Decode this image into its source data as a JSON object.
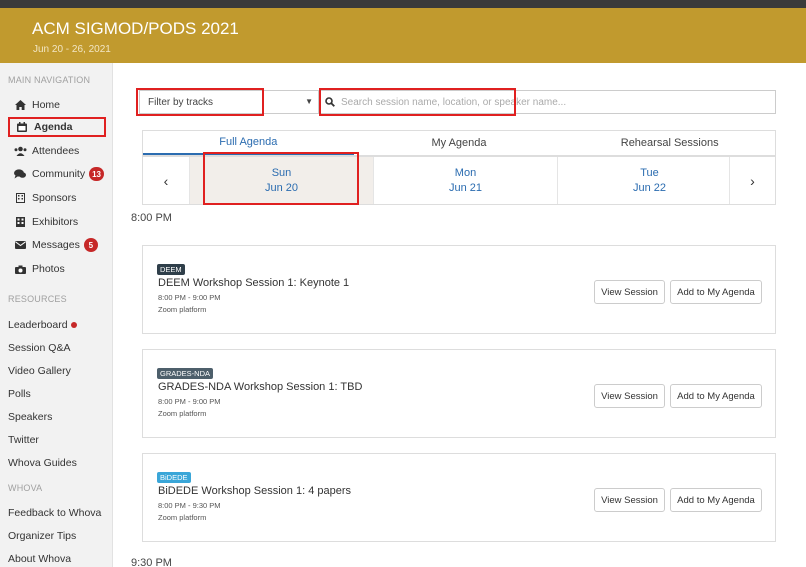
{
  "header": {
    "title": "ACM SIGMOD/PODS 2021",
    "dates": "Jun 20 - 26, 2021"
  },
  "sidebar": {
    "main_heading": "MAIN NAVIGATION",
    "items": [
      {
        "label": "Home",
        "icon": "home-icon"
      },
      {
        "label": "Agenda",
        "icon": "calendar-icon"
      },
      {
        "label": "Attendees",
        "icon": "users-icon"
      },
      {
        "label": "Community",
        "icon": "chat-icon",
        "badge": "13"
      },
      {
        "label": "Sponsors",
        "icon": "building-icon"
      },
      {
        "label": "Exhibitors",
        "icon": "exhibitor-icon"
      },
      {
        "label": "Messages",
        "icon": "envelope-icon",
        "badge": "5"
      },
      {
        "label": "Photos",
        "icon": "camera-icon"
      }
    ],
    "resources_heading": "RESOURCES",
    "resources": [
      "Leaderboard",
      "Session Q&A",
      "Video Gallery",
      "Polls",
      "Speakers",
      "Twitter",
      "Whova Guides"
    ],
    "whova_heading": "WHOVA",
    "whova": [
      "Feedback to Whova",
      "Organizer Tips",
      "About Whova"
    ]
  },
  "filter": {
    "label": "Filter by tracks"
  },
  "search": {
    "placeholder": "Search session name, location, or speaker name..."
  },
  "tabs": [
    "Full Agenda",
    "My Agenda",
    "Rehearsal Sessions"
  ],
  "days": [
    {
      "weekday": "Sun",
      "date": "Jun 20"
    },
    {
      "weekday": "Mon",
      "date": "Jun 21"
    },
    {
      "weekday": "Tue",
      "date": "Jun 22"
    }
  ],
  "times": [
    "8:00 PM",
    "9:30 PM"
  ],
  "sessions": [
    {
      "tag": "DEEM",
      "tag_color": "#2f3f4a",
      "title": "DEEM Workshop Session 1: Keynote 1",
      "time": "8:00 PM - 9:00 PM",
      "location": "Zoom platform"
    },
    {
      "tag": "GRADES-NDA",
      "tag_color": "#4d5f6b",
      "title": "GRADES-NDA Workshop Session 1: TBD",
      "time": "8:00 PM - 9:00 PM",
      "location": "Zoom platform"
    },
    {
      "tag": "BiDEDE",
      "tag_color": "#3aa6d8",
      "title": "BiDEDE Workshop Session 1: 4 papers",
      "time": "8:00 PM - 9:30 PM",
      "location": "Zoom platform"
    }
  ],
  "buttons": {
    "view": "View Session",
    "add": "Add to My Agenda"
  },
  "colors": {
    "header": "#c19a2e",
    "accent": "#2b6cb0",
    "highlight": "#e02020"
  }
}
